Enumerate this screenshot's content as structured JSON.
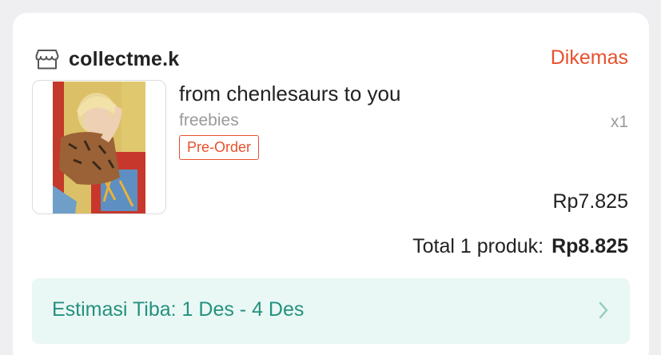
{
  "shop": {
    "icon": "store-icon",
    "name": "collectme.k",
    "status": "Dikemas",
    "status_color": "#e8502d"
  },
  "item": {
    "title": "from chenlesaurs to you",
    "variant": "freebies",
    "quantity": "x1",
    "badge": "Pre-Order",
    "price": "Rp7.825"
  },
  "summary": {
    "total_label": "Total 1 produk:",
    "total_amount": "Rp8.825"
  },
  "delivery": {
    "eta_label": "Estimasi Tiba: 1 Des - 4 Des",
    "eta_color": "#24917f",
    "chevron_icon": "chevron-right-icon"
  }
}
